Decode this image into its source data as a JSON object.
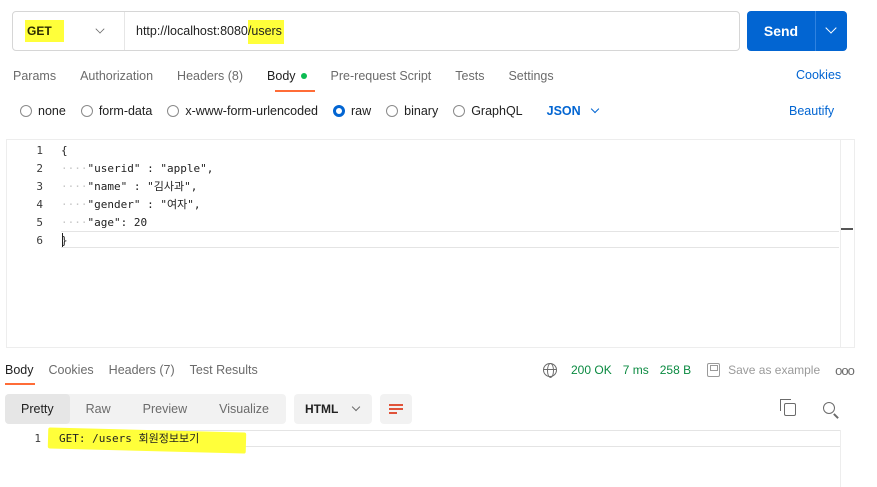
{
  "request": {
    "method": "GET",
    "url": "http://localhost:8080/users",
    "send_label": "Send"
  },
  "request_tabs": [
    {
      "label": "Params",
      "count": ""
    },
    {
      "label": "Authorization",
      "count": ""
    },
    {
      "label": "Headers",
      "count": "(8)"
    },
    {
      "label": "Body",
      "count": ""
    },
    {
      "label": "Pre-request Script",
      "count": ""
    },
    {
      "label": "Tests",
      "count": ""
    },
    {
      "label": "Settings",
      "count": ""
    }
  ],
  "active_request_tab": "Body",
  "cookies_label": "Cookies",
  "body_types": [
    {
      "label": "none",
      "selected": false
    },
    {
      "label": "form-data",
      "selected": false
    },
    {
      "label": "x-www-form-urlencoded",
      "selected": false
    },
    {
      "label": "raw",
      "selected": true
    },
    {
      "label": "binary",
      "selected": false
    },
    {
      "label": "GraphQL",
      "selected": false
    }
  ],
  "raw_format": "JSON",
  "beautify_label": "Beautify",
  "editor": {
    "line_numbers": [
      "1",
      "2",
      "3",
      "4",
      "5",
      "6"
    ],
    "lines": [
      {
        "indent": "",
        "text": "{"
      },
      {
        "indent": "····",
        "text": "\"userid\" : \"apple\","
      },
      {
        "indent": "····",
        "text": "\"name\" : \"김사과\","
      },
      {
        "indent": "····",
        "text": "\"gender\" : \"여자\","
      },
      {
        "indent": "····",
        "text": "\"age\": 20"
      },
      {
        "indent": "",
        "text": "}"
      }
    ]
  },
  "response_tabs": [
    {
      "label": "Body",
      "count": ""
    },
    {
      "label": "Cookies",
      "count": ""
    },
    {
      "label": "Headers",
      "count": "(7)"
    },
    {
      "label": "Test Results",
      "count": ""
    }
  ],
  "active_response_tab": "Body",
  "response_meta": {
    "status": "200 OK",
    "time": "7 ms",
    "size": "258 B",
    "save_label": "Save as example",
    "more": "ooo"
  },
  "view_modes": [
    "Pretty",
    "Raw",
    "Preview",
    "Visualize"
  ],
  "active_view": "Pretty",
  "response_format": "HTML",
  "response_body": {
    "line_numbers": [
      "1"
    ],
    "lines": [
      "GET: /users 회원정보보기"
    ]
  },
  "colors": {
    "accent": "#0265d2",
    "tab_indicator": "#ff6c37",
    "status_ok": "#0b8a41",
    "highlight": "#ffff3a"
  }
}
